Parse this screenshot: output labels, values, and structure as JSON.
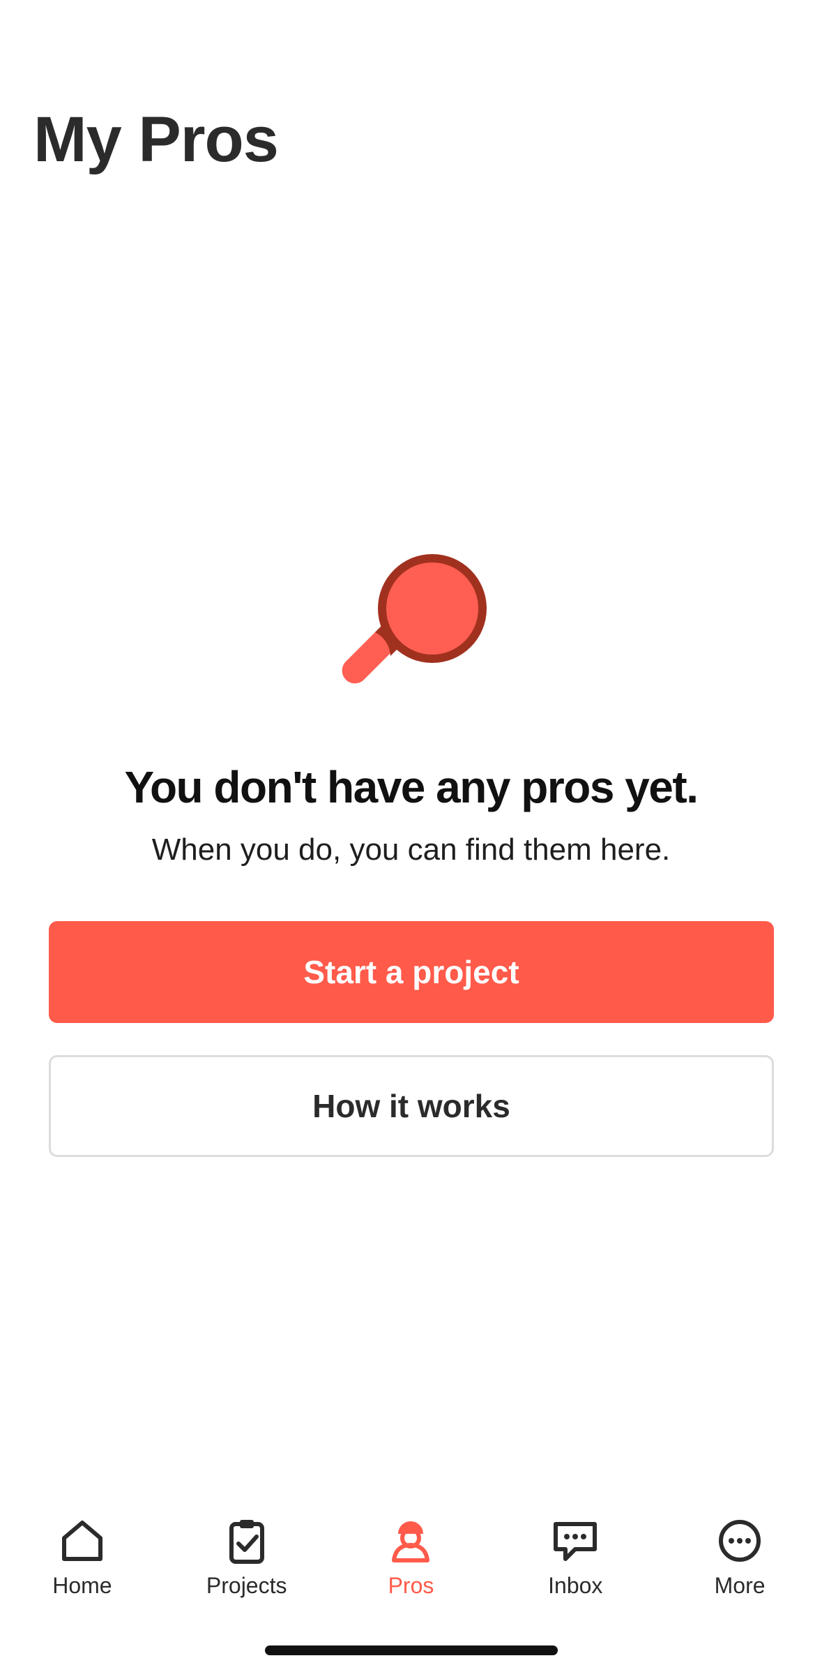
{
  "header": {
    "title": "My Pros"
  },
  "empty_state": {
    "illustration": "magnifying-glass-icon",
    "heading": "You don't have any pros yet.",
    "subtext": "When you do, you can find them here."
  },
  "actions": {
    "primary_label": "Start a project",
    "secondary_label": "How it works"
  },
  "tab_bar": {
    "items": [
      {
        "label": "Home",
        "icon": "home-icon",
        "active": false
      },
      {
        "label": "Projects",
        "icon": "clipboard-check-icon",
        "active": false
      },
      {
        "label": "Pros",
        "icon": "pro-person-icon",
        "active": true
      },
      {
        "label": "Inbox",
        "icon": "chat-bubble-icon",
        "active": false
      },
      {
        "label": "More",
        "icon": "more-dots-icon",
        "active": false
      }
    ]
  },
  "colors": {
    "accent": "#ff5a4a",
    "accent_dark": "#a1311f",
    "text": "#2b2b2b"
  }
}
